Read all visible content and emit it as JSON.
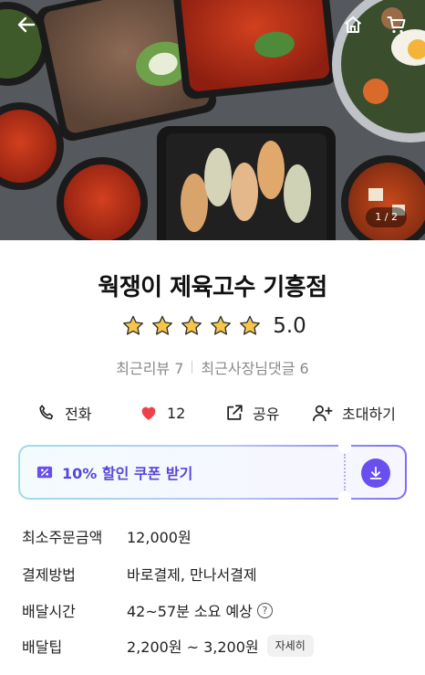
{
  "hero": {
    "counter": "1 / 2",
    "icons": [
      "back-arrow-icon",
      "home-icon",
      "cart-icon"
    ]
  },
  "store": {
    "name": "웍쟁이 제육고수 기흥점",
    "rating": "5.0",
    "rating_stars": 5,
    "star_color": "#f6c64a",
    "recent_reviews": "최근리뷰 7",
    "owner_replies": "최근사장님댓글 6"
  },
  "actions": {
    "call": "전화",
    "like_count": "12",
    "like_color": "#f0414a",
    "share": "공유",
    "invite": "초대하기"
  },
  "coupon": {
    "label": "10% 할인 쿠폰 받기",
    "accent_color": "#6a4ff0"
  },
  "info": {
    "min_order_label": "최소주문금액",
    "min_order_value": "12,000원",
    "payment_label": "결제방법",
    "payment_value": "바로결제, 만나서결제",
    "delivery_time_label": "배달시간",
    "delivery_time_value": "42~57분 소요 예상",
    "tip_label": "배달팁",
    "tip_value": "2,200원 ~ 3,200원",
    "tip_detail": "자세히"
  }
}
